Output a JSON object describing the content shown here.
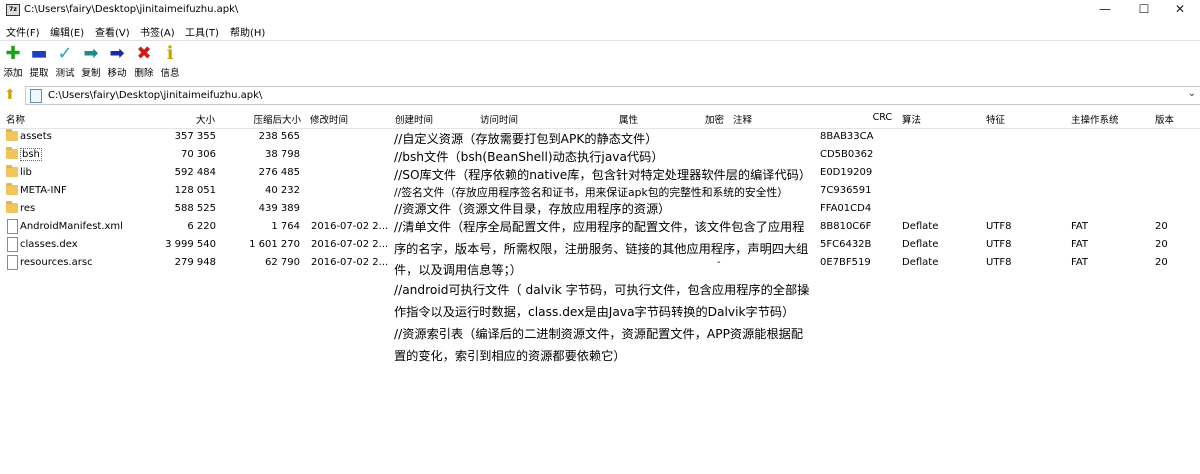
{
  "titlebar": {
    "title": "C:\\Users\\fairy\\Desktop\\jinitaimeifuzhu.apk\\",
    "minimize": "—",
    "maximize": "☐",
    "close": "✕"
  },
  "menu": [
    "文件(F)",
    "编辑(E)",
    "查看(V)",
    "书签(A)",
    "工具(T)",
    "帮助(H)"
  ],
  "toolbar": [
    {
      "label": "添加",
      "icon": "add-icon",
      "glyph": "✚",
      "color": "#1aa31a"
    },
    {
      "label": "提取",
      "icon": "extract-icon",
      "glyph": "▬",
      "color": "#1f3fbf"
    },
    {
      "label": "测试",
      "icon": "test-icon",
      "glyph": "✓",
      "color": "#22a7c9"
    },
    {
      "label": "复制",
      "icon": "copy-icon",
      "glyph": "➡",
      "color": "#1f8a8a"
    },
    {
      "label": "移动",
      "icon": "move-icon",
      "glyph": "➡",
      "color": "#1a2d9e"
    },
    {
      "label": "删除",
      "icon": "delete-icon",
      "glyph": "✖",
      "color": "#d11a1a"
    },
    {
      "label": "信息",
      "icon": "info-icon",
      "glyph": "ℹ",
      "color": "#c9a000"
    }
  ],
  "address": {
    "path": "C:\\Users\\fairy\\Desktop\\jinitaimeifuzhu.apk\\"
  },
  "columns": {
    "name": "名称",
    "size": "大小",
    "packed": "压缩后大小",
    "modified": "修改时间",
    "created": "创建时间",
    "accessed": "访问时间",
    "attributes": "属性",
    "encrypted": "加密",
    "comment": "注释",
    "crc": "CRC",
    "method": "算法",
    "characteristics": "特征",
    "host_os": "主操作系统",
    "version": "版本"
  },
  "files": [
    {
      "type": "folder",
      "name": "assets",
      "size": "357 355",
      "packed": "238 565",
      "modified": "",
      "crc": "8BAB33CA",
      "method": "",
      "characteristics": "",
      "host_os": "",
      "version": ""
    },
    {
      "type": "folder",
      "name": "bsh",
      "size": "70 306",
      "packed": "38 798",
      "modified": "",
      "crc": "CD5B0362",
      "method": "",
      "characteristics": "",
      "host_os": "",
      "version": ""
    },
    {
      "type": "folder",
      "name": "lib",
      "size": "592 484",
      "packed": "276 485",
      "modified": "",
      "crc": "E0D19209",
      "method": "",
      "characteristics": "",
      "host_os": "",
      "version": ""
    },
    {
      "type": "folder",
      "name": "META-INF",
      "size": "128 051",
      "packed": "40 232",
      "modified": "",
      "crc": "7C936591",
      "method": "",
      "characteristics": "",
      "host_os": "",
      "version": ""
    },
    {
      "type": "folder",
      "name": "res",
      "size": "588 525",
      "packed": "439 389",
      "modified": "",
      "crc": "FFA01CD4",
      "method": "",
      "characteristics": "",
      "host_os": "",
      "version": ""
    },
    {
      "type": "file",
      "name": "AndroidManifest.xml",
      "size": "6 220",
      "packed": "1 764",
      "modified": "2016-07-02 2...",
      "crc": "8B810C6F",
      "method": "Deflate",
      "characteristics": "UTF8",
      "host_os": "FAT",
      "version": "20"
    },
    {
      "type": "file",
      "name": "classes.dex",
      "size": "3 999 540",
      "packed": "1 601 270",
      "modified": "2016-07-02 2...",
      "crc": "5FC6432B",
      "method": "Deflate",
      "characteristics": "UTF8",
      "host_os": "FAT",
      "version": "20"
    },
    {
      "type": "file",
      "name": "resources.arsc",
      "size": "279 948",
      "packed": "62 790",
      "modified": "2016-07-02 2...",
      "crc": "0E7BF519",
      "method": "Deflate",
      "characteristics": "UTF8",
      "host_os": "FAT",
      "version": "20"
    }
  ],
  "stray_dash": "-",
  "notes": [
    "//自定义资源（存放需要打包到APK的静态文件）",
    "//bsh文件（bsh(BeanShell)动态执行java代码）",
    "//SO库文件（程序依赖的native库，包含针对特定处理器软件层的编译代码）",
    "//签名文件（存放应用程序签名和证书，用来保证apk包的完整性和系统的安全性）",
    "//资源文件（资源文件目录，存放应用程序的资源）",
    "//清单文件（程序全局配置文件，应用程序的配置文件，该文件包含了应用程",
    "序的名字，版本号，所需权限，注册服务、链接的其他应用程序，声明四大组",
    "件，以及调用信息等；）",
    "//android可执行文件（ dalvik 字节码，可执行文件，包含应用程序的全部操",
    "作指令以及运行时数据，class.dex是由Java字节码转换的Dalvik字节码）",
    "//资源索引表（编译后的二进制资源文件，资源配置文件，APP资源能根据配",
    "置的变化，索引到相应的资源都要依赖它）"
  ]
}
